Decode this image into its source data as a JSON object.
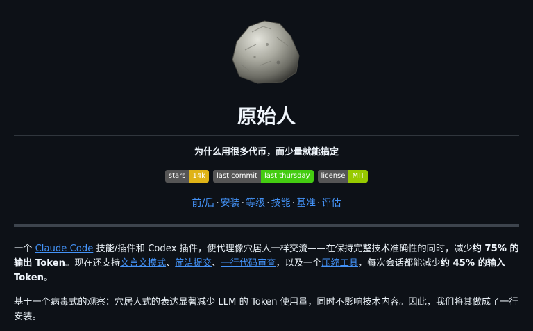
{
  "header": {
    "logo_icon": "rock-icon",
    "title": "原始人",
    "subtitle": "为什么用很多代币，而少量就能搞定"
  },
  "badges": [
    {
      "label": "stars",
      "value": "14k",
      "color": "#dfb317"
    },
    {
      "label": "last commit",
      "value": "last thursday",
      "color": "#4c1"
    },
    {
      "label": "license",
      "value": "MIT",
      "color": "#97ca00"
    }
  ],
  "nav": {
    "links": [
      "前/后",
      "安装",
      "等级",
      "技能",
      "基准",
      "评估"
    ],
    "separator": "·"
  },
  "intro": {
    "t1": "一个 ",
    "link_claude": "Claude Code",
    "t2": " 技能/插件和 Codex 插件，使代理像穴居人一样交流——在保持完整技术准确性的同时，减少",
    "b_output": "约 75% 的输出 Token",
    "t3": "。现在还支持",
    "link_wenyan": "文言文模式",
    "t4": "、",
    "link_commit": "简洁提交",
    "t5": "、",
    "link_review": "一行代码审查",
    "t6": "，以及一个",
    "link_compress": "压缩工具",
    "t7": "，每次会话都能减少",
    "b_input": "约 45% 的输入 Token",
    "t8": "。"
  },
  "para2": {
    "text": "基于一个病毒式的观察：穴居人式的表达显著减少 LLM 的 Token 使用量，同时不影响技术内容。因此，我们将其做成了一行安装。"
  },
  "colors": {
    "background": "#0d1117",
    "text": "#e6edf3",
    "link": "#4493f8",
    "rule": "#3d444d"
  }
}
